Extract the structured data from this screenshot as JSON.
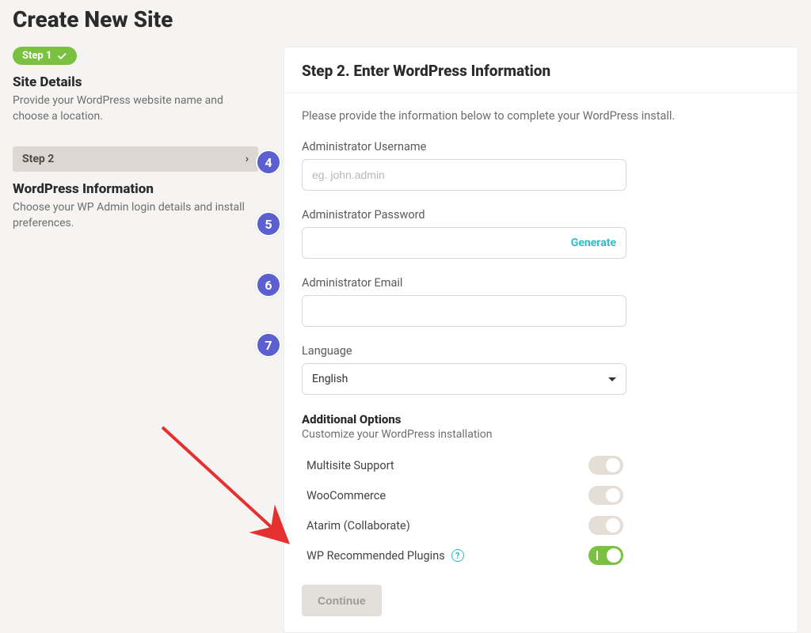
{
  "title": "Create New Site",
  "sidebar": {
    "step1_badge": "Step 1",
    "sec1_heading": "Site Details",
    "sec1_desc": "Provide your WordPress website name and choose a location.",
    "step2_label": "Step 2",
    "sec2_heading": "WordPress Information",
    "sec2_desc": "Choose your WP Admin login details and install preferences."
  },
  "main": {
    "heading": "Step 2. Enter WordPress Information",
    "intro": "Please provide the information below to complete your WordPress install.",
    "fields": {
      "username_label": "Administrator Username",
      "username_placeholder": "eg. john.admin",
      "password_label": "Administrator Password",
      "password_generate": "Generate",
      "email_label": "Administrator Email",
      "language_label": "Language",
      "language_value": "English"
    },
    "addl": {
      "heading": "Additional Options",
      "sub": "Customize your WordPress installation",
      "rows": [
        {
          "label": "Multisite Support",
          "on": false
        },
        {
          "label": "WooCommerce",
          "on": false
        },
        {
          "label": "Atarim (Collaborate)",
          "on": false
        },
        {
          "label": "WP Recommended Plugins",
          "on": true,
          "help": true
        }
      ]
    },
    "continue": "Continue"
  },
  "markers": {
    "m4": "4",
    "m5": "5",
    "m6": "6",
    "m7": "7"
  }
}
